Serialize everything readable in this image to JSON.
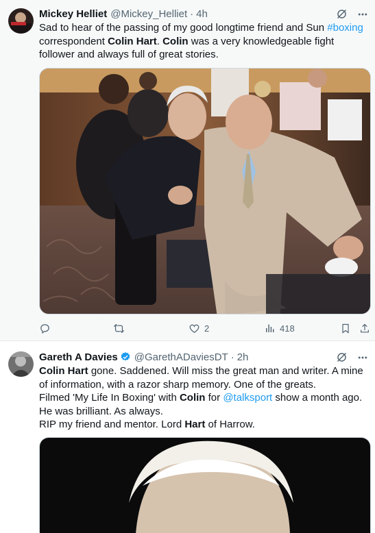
{
  "tweets": [
    {
      "name": "Mickey Helliet",
      "handle": "@Mickey_Helliet",
      "sep": "·",
      "time": "4h",
      "text": {
        "p1": "Sad to hear of the passing of my good longtime friend and Sun ",
        "hashtag": "#boxing",
        "p2": " correspondent ",
        "b1": "Colin Hart",
        "p3": ". ",
        "b2": "Colin",
        "p4": " was a very knowledgeable fight follower and always full of great stories."
      },
      "media": "photo",
      "actions": {
        "reply_icon": "reply-icon",
        "retweet_icon": "retweet-icon",
        "like_icon": "heart-icon",
        "likes": "2",
        "views_icon": "views-icon",
        "views": "418",
        "bookmark_icon": "bookmark-icon",
        "share_icon": "share-icon"
      }
    },
    {
      "name": "Gareth A Davies",
      "handle": "@GarethADaviesDT",
      "sep": "·",
      "time": "2h",
      "verified_icon": "verified-badge-icon",
      "text": {
        "b1": "Colin Hart",
        "p1": " gone. Saddened. Will miss the great man and writer. A mine of information, with a razor sharp memory. One of the greats.",
        "p2": "Filmed 'My Life In Boxing' with ",
        "b2": "Colin",
        "p3": " for ",
        "mention": "@talksport",
        "p4": " show a month ago. He was brilliant. As always.",
        "p5": "RIP my friend and mentor. Lord ",
        "b3": "Hart",
        "p6": " of Harrow."
      },
      "media": "photo"
    }
  ],
  "colors": {
    "link": "#1d9bf0",
    "secondary": "#536471",
    "hover_bg": "#f7f9f9"
  }
}
